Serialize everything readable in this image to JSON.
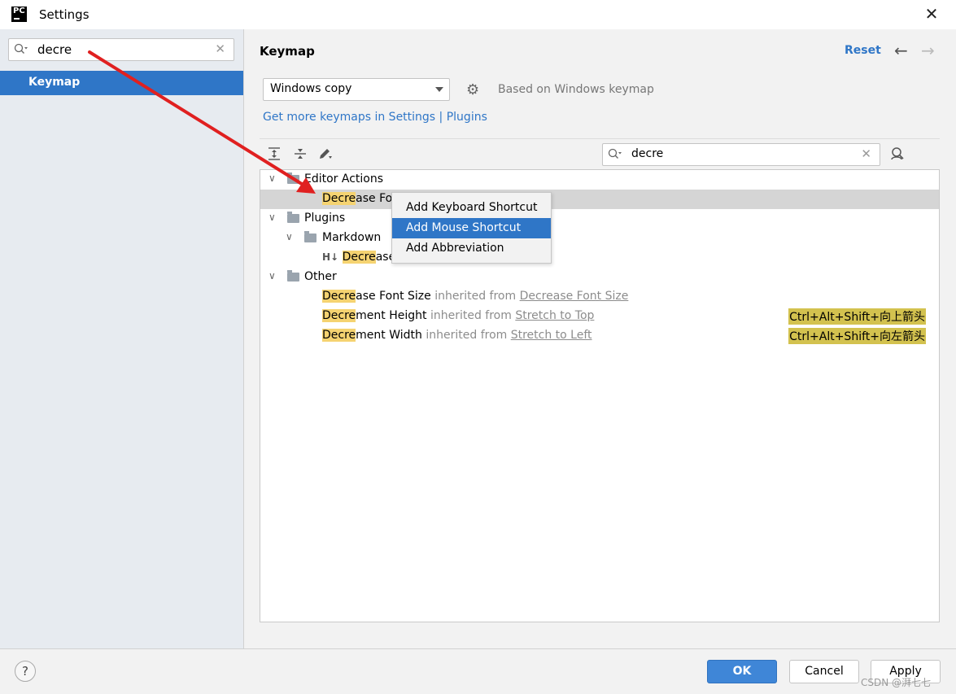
{
  "window": {
    "title": "Settings",
    "app_icon_text": "PC"
  },
  "sidebar": {
    "search": {
      "value": "decre"
    },
    "items": [
      {
        "label": "Keymap",
        "selected": true
      }
    ]
  },
  "main": {
    "title": "Keymap",
    "reset_label": "Reset",
    "keymap_select": {
      "value": "Windows copy"
    },
    "based_on": "Based on Windows keymap",
    "get_more_link": "Get more keymaps in Settings | Plugins",
    "tree_search": {
      "value": "decre"
    }
  },
  "tree": {
    "editor_actions": {
      "label": "Editor Actions",
      "child_hl": "Decre",
      "child_rest": "ase Fo"
    },
    "plugins": {
      "label": "Plugins",
      "markdown": {
        "label": "Markdown",
        "child_prefix": "H↓",
        "child_hl": "Decre",
        "child_rest": "ase"
      }
    },
    "other": {
      "label": "Other",
      "rows": [
        {
          "hl": "Decre",
          "rest": "ase Font Size",
          "inherited": "inherited from",
          "source": "Decrease Font Size",
          "shortcut": ""
        },
        {
          "hl": "Decre",
          "rest": "ment Height",
          "inherited": "inherited from",
          "source": "Stretch to Top",
          "shortcut": "Ctrl+Alt+Shift+向上箭头"
        },
        {
          "hl": "Decre",
          "rest": "ment Width",
          "inherited": "inherited from",
          "source": "Stretch to Left",
          "shortcut": "Ctrl+Alt+Shift+向左箭头"
        }
      ]
    }
  },
  "context_menu": {
    "items": [
      {
        "label": "Add Keyboard Shortcut",
        "active": false
      },
      {
        "label": "Add Mouse Shortcut",
        "active": true
      },
      {
        "label": "Add Abbreviation",
        "active": false
      }
    ]
  },
  "footer": {
    "help_label": "?",
    "ok_label": "OK",
    "cancel_label": "Cancel",
    "apply_label": "Apply",
    "watermark": "CSDN @湃七七"
  },
  "colors": {
    "accent": "#2f76c7",
    "highlight": "#f5d371",
    "shortcut_badge": "#d3c24f",
    "annotation_arrow": "#e02020"
  }
}
